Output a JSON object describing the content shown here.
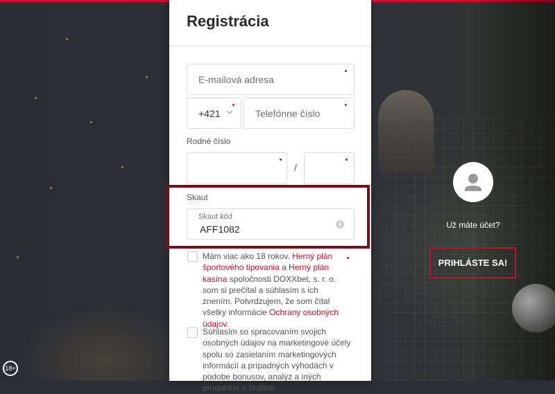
{
  "form": {
    "title": "Registrácia",
    "email_placeholder": "E-mailová adresa",
    "phone_prefix": "+421",
    "phone_placeholder": "Telefónne číslo",
    "birth_number_label": "Rodné číslo",
    "birth_number_separator": "/",
    "scout_label": "Skaut",
    "scout_code_placeholder": "Skaut kód",
    "scout_code_value": "AFF1082",
    "consent1": {
      "text_a": "Mám viac ako 18 rokov. ",
      "link_a": "Herný plán športového tipovania",
      "text_b": " a ",
      "link_b": "Herný plán kasína",
      "text_c": " spoločnosti DOXXbet, s. r. o. som si prečítal a súhlasím s ich znením. Potvrdzujem, že som čítal všetky informácie ",
      "link_c": "Ochrany osobných údajov",
      "text_d": "."
    },
    "consent2_text": "Súhlasím so spracovaním svojich osobných údajov na marketingové účely spolu so zasielaním marketingových informácií a prípadných výhodách v podobe bonusov, analýz a iných produktov a služieb."
  },
  "login": {
    "question": "Už máte účet?",
    "button_label": "PRIHLÁSTE SA!"
  },
  "age_badge": "18+",
  "colors": {
    "accent": "#c8102e",
    "highlight_border": "#7a0c17",
    "background": "#2b2e35"
  },
  "icons": [
    "user-icon",
    "info-icon",
    "chevron-down-icon"
  ]
}
